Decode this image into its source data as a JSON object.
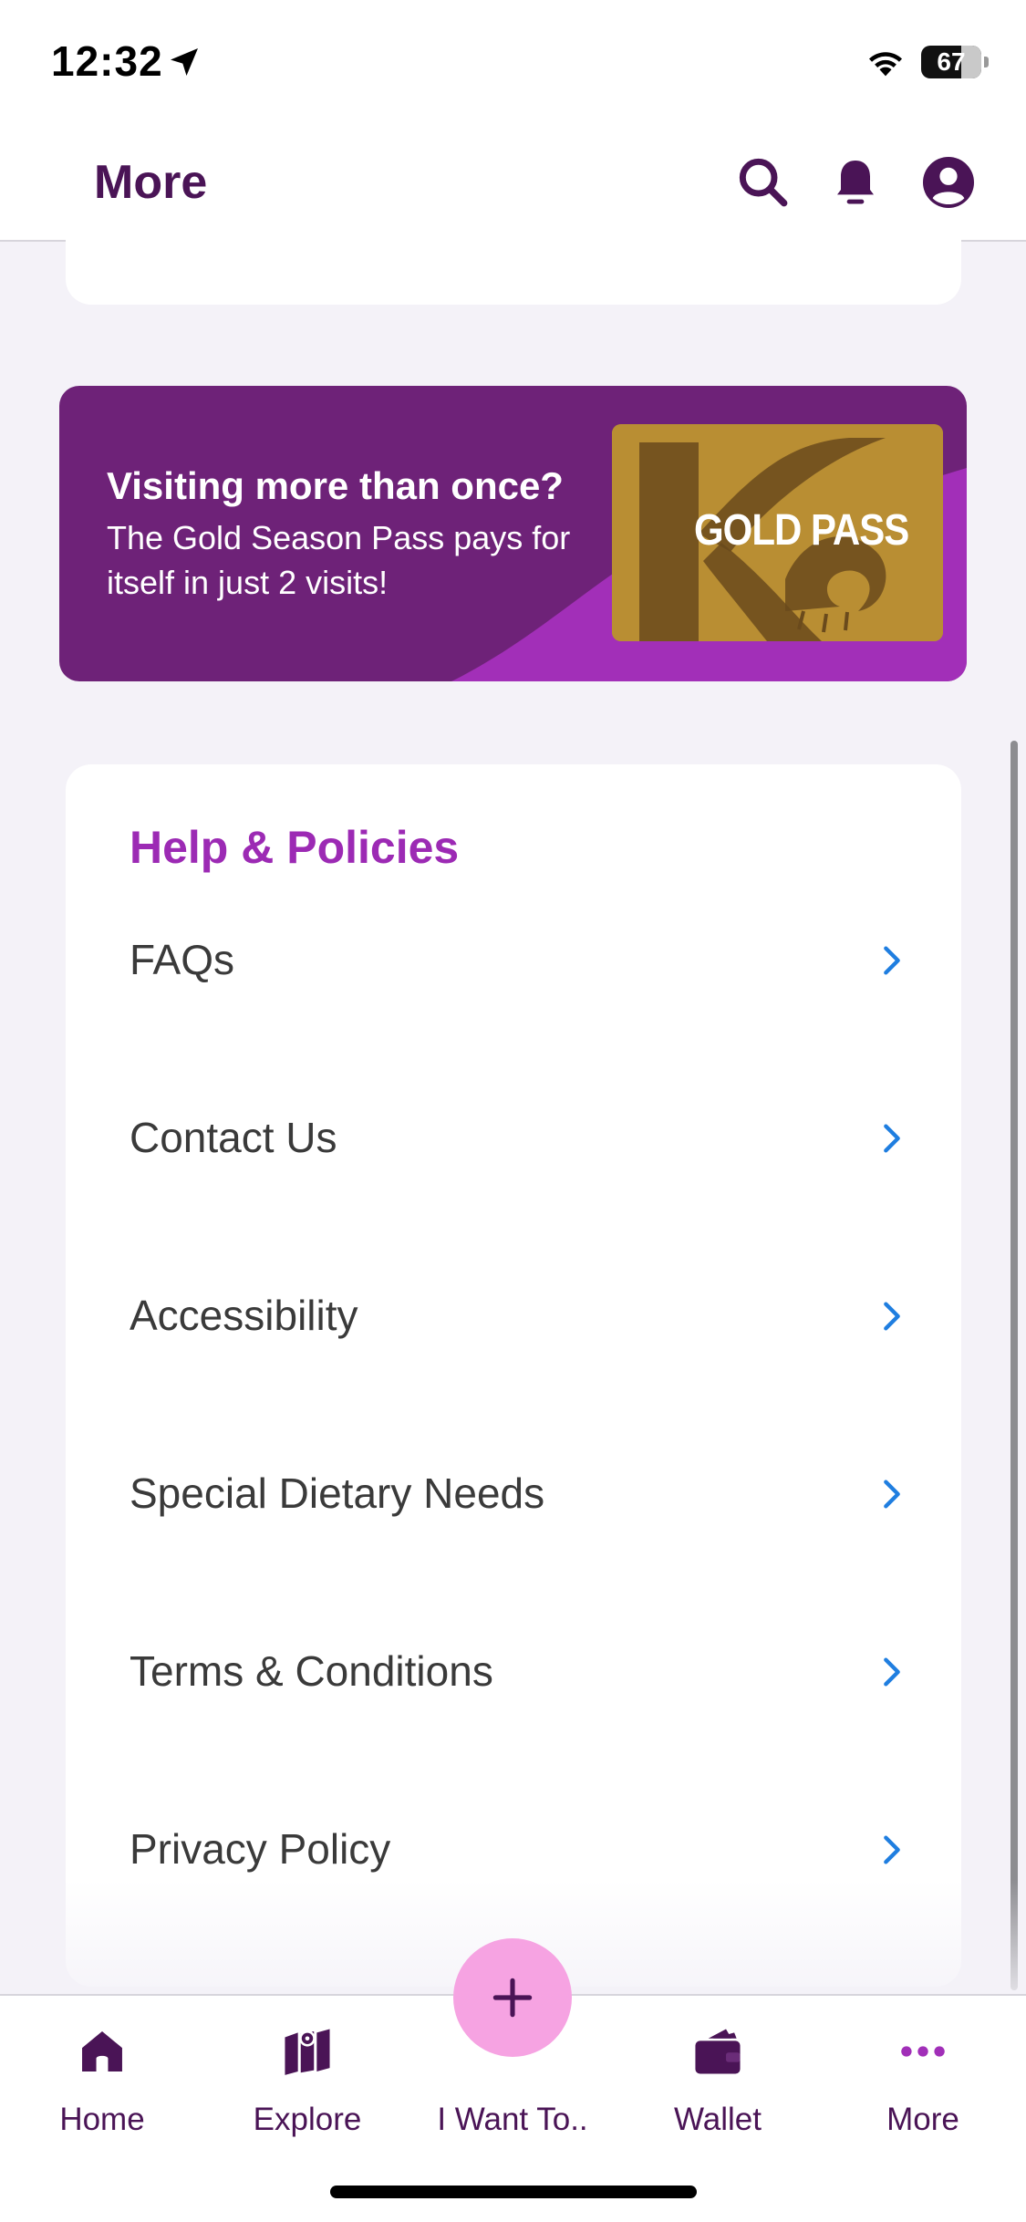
{
  "status_bar": {
    "time": "12:32",
    "battery": "67"
  },
  "header": {
    "title": "More"
  },
  "banner": {
    "headline": "Visiting more than once?",
    "subtext": "The Gold Season Pass pays for itself in just 2 visits!",
    "card_label": "GOLD PASS"
  },
  "help": {
    "title": "Help & Policies",
    "items": [
      {
        "label": "FAQs"
      },
      {
        "label": "Contact Us"
      },
      {
        "label": "Accessibility"
      },
      {
        "label": "Special Dietary Needs"
      },
      {
        "label": "Terms & Conditions"
      },
      {
        "label": "Privacy Policy"
      }
    ]
  },
  "tabs": [
    {
      "label": "Home",
      "icon": "home-icon"
    },
    {
      "label": "Explore",
      "icon": "map-icon"
    },
    {
      "label": "I Want To..",
      "icon": "plus-icon"
    },
    {
      "label": "Wallet",
      "icon": "wallet-icon"
    },
    {
      "label": "More",
      "icon": "more-dots-icon"
    }
  ],
  "colors": {
    "brand": "#4a1456",
    "accent": "#9c2ab4",
    "chevron": "#1f7ee0",
    "fab": "#f6a3e2",
    "gold": "#b58a2f"
  }
}
